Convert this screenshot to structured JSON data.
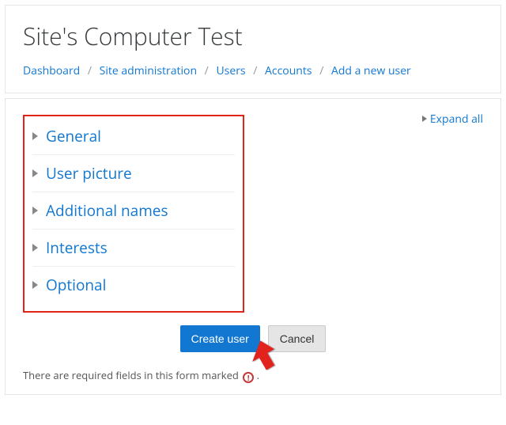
{
  "header": {
    "title": "Site's Computer Test"
  },
  "breadcrumb": {
    "items": [
      "Dashboard",
      "Site administration",
      "Users",
      "Accounts",
      "Add a new user"
    ]
  },
  "form": {
    "expand_all_label": "Expand all",
    "sections": [
      {
        "label": "General"
      },
      {
        "label": "User picture"
      },
      {
        "label": "Additional names"
      },
      {
        "label": "Interests"
      },
      {
        "label": "Optional"
      }
    ],
    "actions": {
      "submit_label": "Create user",
      "cancel_label": "Cancel"
    },
    "required_note": "There are required fields in this form marked",
    "required_icon_glyph": "!"
  },
  "annotations": {
    "highlight_box_color": "#e2231a",
    "arrow_color": "#e2231a"
  }
}
